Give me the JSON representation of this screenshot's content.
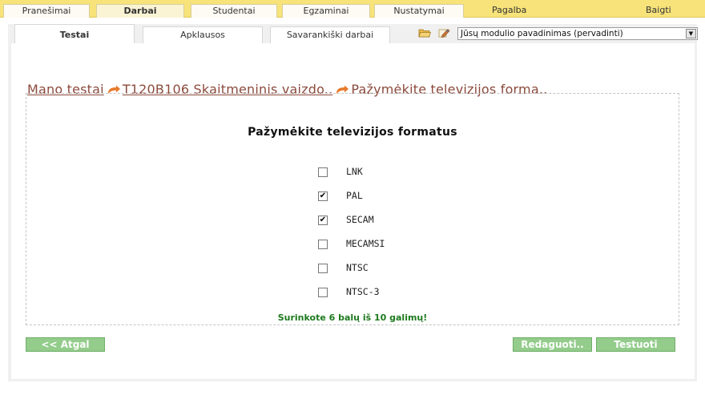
{
  "topmenu": {
    "tabs": [
      "Pranešimai",
      "Darbai",
      "Studentai",
      "Egzaminai",
      "Nustatymai"
    ],
    "help": "Pagalba",
    "exit": "Baigti"
  },
  "subtabs": [
    "Testai",
    "Apklausos",
    "Savarankiški darbai"
  ],
  "module_select": {
    "value": "Jūsų modulio pavadinimas (pervadinti)"
  },
  "breadcrumb": {
    "root": "Mano testai",
    "course": "T120B106 Skaitmeninis vaizdo..",
    "current": "Pažymėkite televizijos forma.."
  },
  "question": {
    "title": "Pažymėkite televizijos formatus",
    "options": [
      {
        "label": "LNK",
        "checked": false
      },
      {
        "label": "PAL",
        "checked": true
      },
      {
        "label": "SECAM",
        "checked": true
      },
      {
        "label": "MECAMSI",
        "checked": false
      },
      {
        "label": "NTSC",
        "checked": false
      },
      {
        "label": "NTSC-3",
        "checked": false
      }
    ],
    "score_text": "Surinkote 6 balų iš 10 galimų!"
  },
  "buttons": {
    "back": "<< Atgal",
    "edit": "Redaguoti..",
    "test": "Testuoti"
  },
  "colors": {
    "menu_bg": "#f7e37a",
    "crumb": "#8b4a3c",
    "score": "#1e7a1e",
    "button": "#93cc8b"
  }
}
